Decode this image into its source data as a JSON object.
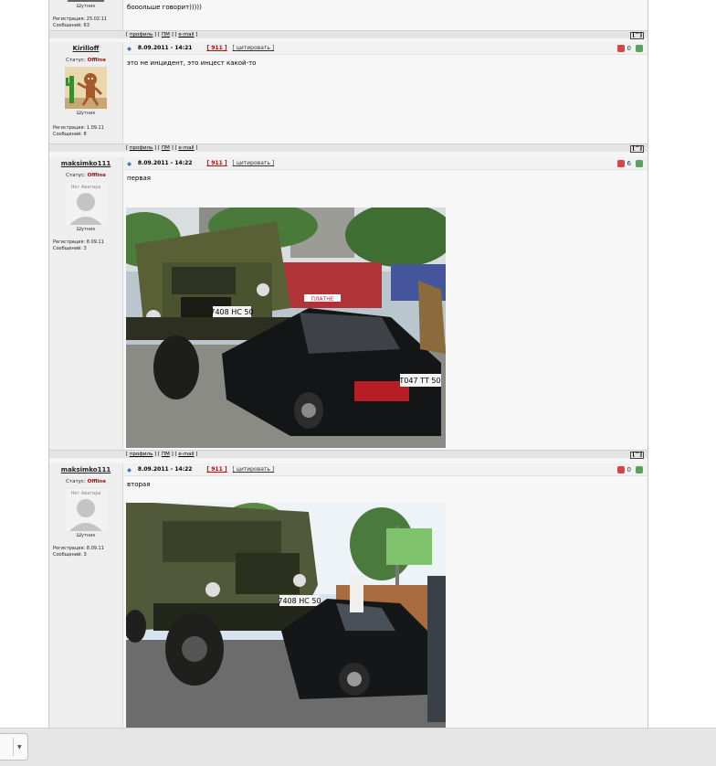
{
  "post0": {
    "rank": "Шутник",
    "reg": "Регистрация: 25.02.11",
    "msgs": "Сообщений: 63",
    "text": "бооольше говорит)))))",
    "links": {
      "profile": "профиль",
      "pm": "ПМ",
      "email": "e-mail"
    },
    "up": "[^]"
  },
  "post1": {
    "nick": "Kirilloff",
    "status_label": "Статус:",
    "status_value": "Offline",
    "rank": "Шутник",
    "reg": "Регистрация: 1.09.11",
    "msgs": "Сообщений: 8",
    "date": "8.09.2011 - 14:21",
    "num": "911",
    "quote": "цитировать",
    "rating": "0",
    "text": "это не инцидент, это инцест какой-то",
    "links": {
      "profile": "профиль",
      "pm": "ПМ",
      "email": "e-mail"
    },
    "up": "[^]"
  },
  "post2": {
    "nick": "maksimko111",
    "status_label": "Статус:",
    "status_value": "Offline",
    "avatar_text": "Нет Аватара",
    "rank": "Шутник",
    "reg": "Регистрация: 8.09.11",
    "msgs": "Сообщений: 3",
    "date": "8.09.2011 - 14:22",
    "num": "911",
    "quote": "цитировать",
    "rating": "6",
    "text": "первая",
    "plate_truck": "7408 НС 50",
    "plate_car": "Т047 ТТ 50",
    "sign": "ПЛАТНЕ",
    "links": {
      "profile": "профиль",
      "pm": "ПМ",
      "email": "e-mail"
    },
    "up": "[^]"
  },
  "post3": {
    "nick": "maksimko111",
    "status_label": "Статус:",
    "status_value": "Offline",
    "avatar_text": "Нет Аватара",
    "rank": "Шутник",
    "reg": "Регистрация: 8.09.11",
    "msgs": "Сообщений: 3",
    "date": "8.09.2011 - 14:22",
    "num": "911",
    "quote": "цитировать",
    "rating": "0",
    "text": "вторая",
    "plate_truck": "7408 НС 50"
  },
  "colors": {
    "offline": "#c00000",
    "neg": "#d14747",
    "pos": "#57a35c"
  }
}
